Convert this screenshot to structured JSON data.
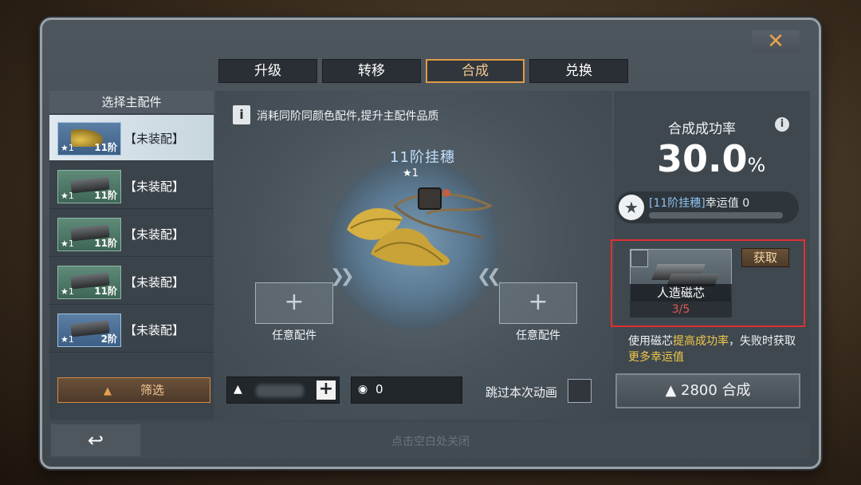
{
  "close_label": "✕",
  "tabs": [
    {
      "label": "升级",
      "active": false
    },
    {
      "label": "转移",
      "active": false
    },
    {
      "label": "合成",
      "active": true
    },
    {
      "label": "兑换",
      "active": false
    }
  ],
  "left": {
    "title": "选择主配件",
    "items": [
      {
        "star": "★1",
        "level": "11阶",
        "label": "【未装配】",
        "selected": true
      },
      {
        "star": "★1",
        "level": "11阶",
        "label": "【未装配】",
        "selected": false
      },
      {
        "star": "★1",
        "level": "11阶",
        "label": "【未装配】",
        "selected": false
      },
      {
        "star": "★1",
        "level": "11阶",
        "label": "【未装配】",
        "selected": false
      },
      {
        "star": "★1",
        "level": "2阶",
        "label": "【未装配】",
        "selected": false
      }
    ],
    "filter_label": "筛选",
    "filter_icon": "▲"
  },
  "center": {
    "info_icon": "i",
    "info_text": "消耗同阶同颜色配件,提升主配件品质",
    "main_name": "11阶挂穗",
    "main_star": "★1",
    "slot_plus": "+",
    "slot_left_label": "任意配件",
    "slot_right_label": "任意配件",
    "currency1_icon": "▲",
    "currency1_plus": "+",
    "currency2_icon": "◉",
    "currency2_amount": "0",
    "skip_label": "跳过本次动画"
  },
  "right": {
    "rate_title": "合成成功率",
    "rate_info": "i",
    "rate_value": "30.0",
    "rate_unit": "%",
    "luck_star": "★",
    "luck_item": "[11阶挂穗]",
    "luck_label": "幸运值",
    "luck_value": "0",
    "core_name": "人造磁芯",
    "core_count": "3/5",
    "get_label": "获取",
    "tip_part1": "使用磁芯",
    "tip_hl1": "提高成功率",
    "tip_part2": "，失败时获取",
    "tip_hl2": "更多幸运值",
    "compose_icon": "▲",
    "compose_cost": "2800",
    "compose_label": "合成"
  },
  "bottom": {
    "back_icon": "↩",
    "hint": "点击空白处关闭"
  },
  "colors": {
    "accent": "#e09a4a",
    "highlight": "#f2c84a",
    "warning": "#e03030"
  }
}
